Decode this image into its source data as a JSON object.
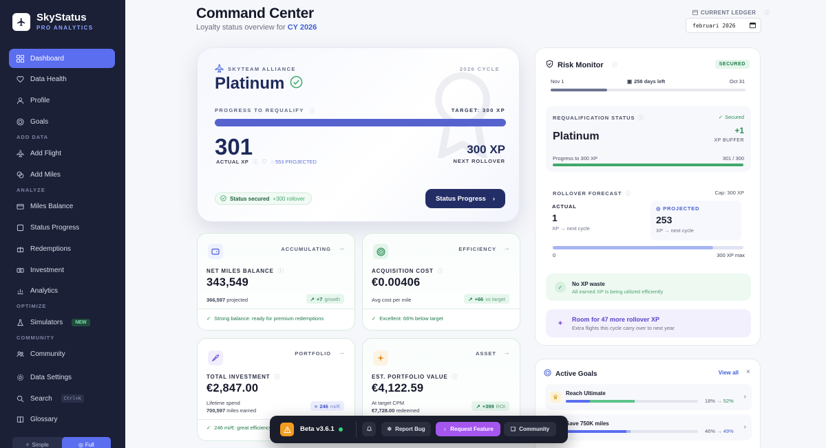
{
  "brand": {
    "name": "SkyStatus",
    "subtitle": "PRO ANALYTICS",
    "logo_icon": "airplane-icon"
  },
  "sidebar": {
    "items": [
      {
        "label": "Dashboard",
        "icon": "grid-icon",
        "active": true
      },
      {
        "label": "Data Health",
        "icon": "heart-icon"
      },
      {
        "label": "Profile",
        "icon": "user-icon"
      },
      {
        "label": "Goals",
        "icon": "target-icon"
      }
    ],
    "sections": [
      {
        "label": "ADD DATA",
        "items": [
          {
            "label": "Add Flight",
            "icon": "plane-icon"
          },
          {
            "label": "Add Miles",
            "icon": "coins-icon"
          }
        ]
      },
      {
        "label": "ANALYZE",
        "items": [
          {
            "label": "Miles Balance",
            "icon": "wallet-icon"
          },
          {
            "label": "Status Progress",
            "icon": "medal-icon"
          },
          {
            "label": "Redemptions",
            "icon": "gift-icon"
          },
          {
            "label": "Investment",
            "icon": "money-icon"
          },
          {
            "label": "Analytics",
            "icon": "chart-icon"
          }
        ]
      },
      {
        "label": "OPTIMIZE",
        "items": [
          {
            "label": "Simulators",
            "icon": "beaker-icon",
            "badge": "NEW"
          }
        ]
      },
      {
        "label": "COMMUNITY",
        "items": [
          {
            "label": "Community",
            "icon": "people-icon"
          }
        ]
      }
    ],
    "bottom": [
      {
        "label": "Data Settings",
        "icon": "gear-icon"
      },
      {
        "label": "Search",
        "icon": "search-icon",
        "shortcut": "Ctrl+K"
      },
      {
        "label": "Glossary",
        "icon": "book-icon"
      }
    ],
    "mode": {
      "simple": "Simple",
      "full": "Full"
    }
  },
  "header": {
    "title": "Command Center",
    "subtitle_prefix": "Loyalty status overview for",
    "subtitle_year": "CY 2026",
    "ledger_label": "CURRENT LEDGER",
    "ledger_value": "februari 2026"
  },
  "hero": {
    "alliance": "SKYTEAM ALLIANCE",
    "cycle": "2026 CYCLE",
    "tier": "Platinum",
    "progress_label": "PROGRESS TO REQUALIFY",
    "target": "TARGET: 300 XP",
    "progress_fraction": 1.0,
    "actual_xp": "301",
    "actual_label": "ACTUAL XP",
    "projected": "553 PROJECTED",
    "rollover_value": "300 XP",
    "rollover_label": "NEXT ROLLOVER",
    "status_pill": "Status secured",
    "status_pill_extra": "+300 rollover",
    "button": "Status Progress"
  },
  "cards": {
    "miles": {
      "kind": "ACCUMULATING",
      "label": "NET MILES BALANCE",
      "value": "343,549",
      "sub_value": "366,597",
      "sub_text": "projected",
      "chip_value": "+7",
      "chip_text": "growth",
      "foot": "Strong balance: ready for premium redemptions"
    },
    "acq": {
      "kind": "EFFICIENCY",
      "label": "ACQUISITION COST",
      "value": "€0.00406",
      "sub_text": "Avg cost per mile",
      "chip_value": "+66",
      "chip_text": "vs target",
      "foot": "Excellent: 66% below target"
    },
    "invest": {
      "kind": "PORTFOLIO",
      "label": "TOTAL INVESTMENT",
      "value": "€2,847.00",
      "sub_line1": "Lifetime spend",
      "sub_value": "700,597",
      "sub_text": "miles earned",
      "chip_value": "246",
      "chip_text": "mi/€",
      "foot": "246 mi/€: great efficiency"
    },
    "portfolio": {
      "kind": "ASSET",
      "label": "EST. PORTFOLIO VALUE",
      "value": "€4,122.59",
      "sub_line1": "At target CPM",
      "sub_value": "€7,728.00",
      "sub_text": "redeemed",
      "chip_value": "+399",
      "chip_text": "ROI"
    }
  },
  "risk": {
    "title": "Risk Monitor",
    "badge": "SECURED",
    "start": "Nov 1",
    "days_left": "258 days left",
    "end": "Oct 31",
    "timeline_fraction": 0.29,
    "req_label": "REQUALIFICATION STATUS",
    "req_status": "Secured",
    "req_tier": "Platinum",
    "buffer_value": "+1",
    "buffer_label": "XP BUFFER",
    "progress_to": "Progress to 300 XP",
    "progress_val": "301 / 300",
    "rollover_label": "ROLLOVER FORECAST",
    "cap": "Cap: 300 XP",
    "actual_h": "ACTUAL",
    "actual_v": "1",
    "actual_s": "XP → next cycle",
    "proj_h": "PROJECTED",
    "proj_v": "253",
    "proj_s": "XP → next cycle",
    "rollover_fraction": 0.84,
    "scale_min": "0",
    "scale_max": "300 XP max",
    "note1_title": "No XP waste",
    "note1_sub": "All earned XP is being utilized efficiently",
    "note2_title": "Room for 47 more rollover XP",
    "note2_sub": "Extra flights this cycle carry over to next year"
  },
  "goals": {
    "title": "Active Goals",
    "view_all": "View all",
    "items": [
      {
        "name": "Reach Ultimate",
        "from": "18%",
        "to": "52%",
        "from_frac": 0.18,
        "to_frac": 0.52,
        "icon": "crown-icon"
      },
      {
        "name": "Save 750K miles",
        "from": "46%",
        "to": "49%",
        "from_frac": 0.46,
        "to_frac": 0.49,
        "icon": "piggy-icon"
      }
    ]
  },
  "floatbar": {
    "version": "Beta v3.6.1",
    "report": "Report Bug",
    "request": "Request Feature",
    "community": "Community"
  },
  "colors": {
    "accent": "#5b6ef0",
    "sidebar": "#1b2036",
    "success": "#3fa96b",
    "navy": "#242e66",
    "purple": "#a456ef"
  }
}
